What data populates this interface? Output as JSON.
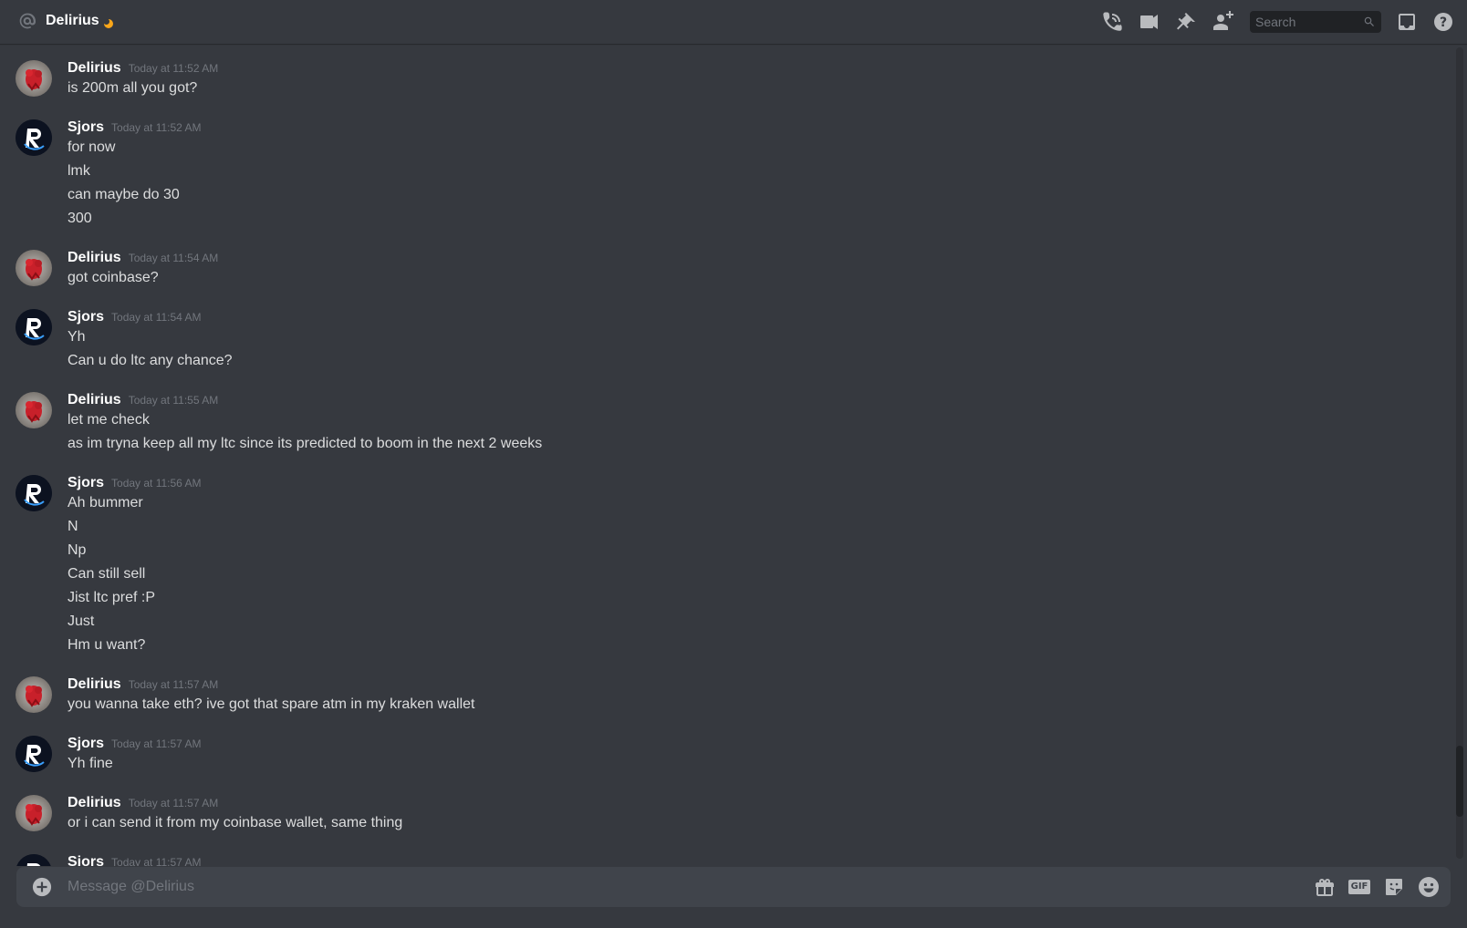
{
  "header": {
    "title": "Delirius",
    "search_placeholder": "Search",
    "icons": [
      "at-icon",
      "moon-status-icon",
      "call-icon",
      "video-icon",
      "pin-icon",
      "add-friend-icon",
      "search-icon",
      "inbox-icon",
      "help-icon"
    ],
    "status_color": "#faa61a"
  },
  "messages": [
    {
      "author": "Delirius",
      "timestamp": "Today at 11:52 AM",
      "lines": [
        "is 200m all you got?"
      ]
    },
    {
      "author": "Sjors",
      "timestamp": "Today at 11:52 AM",
      "lines": [
        "for now",
        "lmk",
        "can maybe do 30",
        "300"
      ]
    },
    {
      "author": "Delirius",
      "timestamp": "Today at 11:54 AM",
      "lines": [
        "got coinbase?"
      ]
    },
    {
      "author": "Sjors",
      "timestamp": "Today at 11:54 AM",
      "lines": [
        "Yh",
        "Can u do ltc any chance?"
      ]
    },
    {
      "author": "Delirius",
      "timestamp": "Today at 11:55 AM",
      "lines": [
        "let me check",
        "as im tryna keep all my ltc since its predicted to boom in the next 2 weeks"
      ]
    },
    {
      "author": "Sjors",
      "timestamp": "Today at 11:56 AM",
      "lines": [
        "Ah bummer",
        "N",
        "Np",
        "Can still sell",
        "Jist ltc pref :P",
        "Just",
        "Hm u want?"
      ]
    },
    {
      "author": "Delirius",
      "timestamp": "Today at 11:57 AM",
      "lines": [
        "you wanna take eth? ive got that spare atm in my kraken wallet"
      ]
    },
    {
      "author": "Sjors",
      "timestamp": "Today at 11:57 AM",
      "lines": [
        "Yh fine"
      ]
    },
    {
      "author": "Delirius",
      "timestamp": "Today at 11:57 AM",
      "lines": [
        "or i can send it from my coinbase wallet, same thing"
      ]
    },
    {
      "author": "Sjors",
      "timestamp": "Today at 11:57 AM",
      "lines": []
    }
  ],
  "composer": {
    "placeholder": "Message @Delirius",
    "value": "",
    "icons": [
      "add-attachment-icon",
      "gift-icon",
      "gif-icon",
      "sticker-icon",
      "emoji-icon"
    ],
    "gif_label": "GIF"
  },
  "colors": {
    "background": "#36393f",
    "composer": "#40444b",
    "username": "#ffffff",
    "text": "#dcddde",
    "muted": "#72767d"
  }
}
